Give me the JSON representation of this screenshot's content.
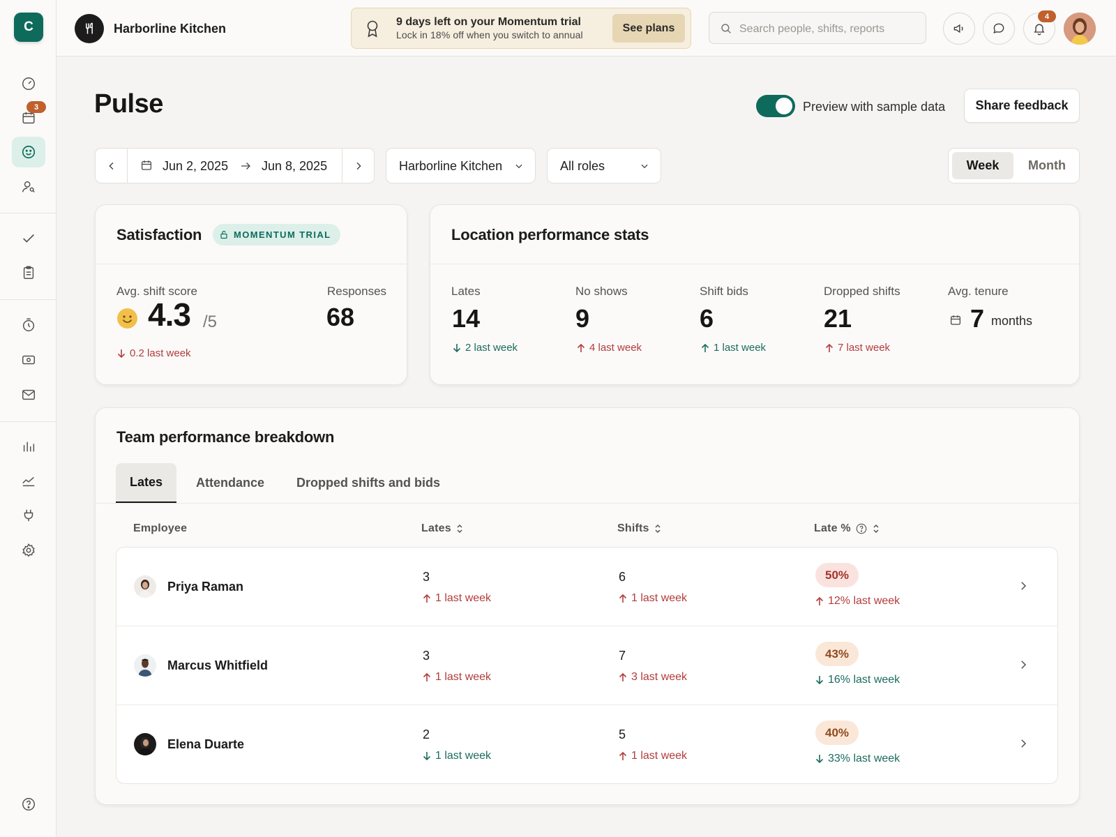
{
  "app": {
    "logo_letter": "C",
    "org_name": "Harborline Kitchen"
  },
  "sidebar": {
    "schedule_badge": "3",
    "items": [
      {
        "name": "dashboard"
      },
      {
        "name": "schedule"
      },
      {
        "name": "pulse"
      },
      {
        "name": "team"
      },
      {
        "name": "tasks"
      },
      {
        "name": "checklists"
      },
      {
        "name": "timesheets"
      },
      {
        "name": "payroll"
      },
      {
        "name": "messages"
      },
      {
        "name": "reports"
      },
      {
        "name": "insights"
      },
      {
        "name": "integrations"
      },
      {
        "name": "settings"
      },
      {
        "name": "help"
      }
    ]
  },
  "banner": {
    "title": "9 days left on your Momentum trial",
    "subtitle": "Lock in 18% off when you switch to annual",
    "cta": "See plans"
  },
  "search": {
    "placeholder": "Search people, shifts, reports"
  },
  "notifications": {
    "count": "4"
  },
  "page": {
    "title": "Pulse",
    "toggle_label": "Preview with sample data",
    "toggle_on": true,
    "share_label": "Share feedback"
  },
  "filters": {
    "start_date": "Jun 2, 2025",
    "end_date": "Jun 8, 2025",
    "location": "Harborline Kitchen",
    "role": "All roles",
    "period_options": [
      "Week",
      "Month"
    ],
    "period_selected": "Week"
  },
  "satisfaction": {
    "title": "Satisfaction",
    "badge": "MOMENTUM TRIAL",
    "score_label": "Avg. shift score",
    "score": "4.3",
    "score_max": "/5",
    "score_trend": "0.2 last week",
    "responses_label": "Responses",
    "responses": "68"
  },
  "location_stats": {
    "title": "Location performance stats",
    "stats": [
      {
        "label": "Lates",
        "value": "14",
        "trend": "2 last week",
        "direction": "down",
        "tone": "green"
      },
      {
        "label": "No shows",
        "value": "9",
        "trend": "4 last week",
        "direction": "up",
        "tone": "red"
      },
      {
        "label": "Shift bids",
        "value": "6",
        "trend": "1 last week",
        "direction": "up",
        "tone": "green"
      },
      {
        "label": "Dropped shifts",
        "value": "21",
        "trend": "7 last week",
        "direction": "up",
        "tone": "red"
      },
      {
        "label": "Avg. tenure",
        "value": "7",
        "unit": "months"
      }
    ]
  },
  "team": {
    "title": "Team performance breakdown",
    "tabs": [
      "Lates",
      "Attendance",
      "Dropped shifts and bids"
    ],
    "active_tab": "Lates",
    "columns": [
      "Employee",
      "Lates",
      "Shifts",
      "Late %"
    ],
    "rows": [
      {
        "name": "Priya Raman",
        "lates": "3",
        "lates_trend": "1 last week",
        "lates_dir": "up",
        "lates_tone": "red",
        "shifts": "6",
        "shifts_trend": "1 last week",
        "shifts_dir": "up",
        "shifts_tone": "red",
        "late_pct": "50%",
        "pct_trend": "12% last week",
        "pct_dir": "up",
        "pct_tone": "red",
        "pill": "hi"
      },
      {
        "name": "Marcus Whitfield",
        "lates": "3",
        "lates_trend": "1 last week",
        "lates_dir": "up",
        "lates_tone": "red",
        "shifts": "7",
        "shifts_trend": "3 last week",
        "shifts_dir": "up",
        "shifts_tone": "red",
        "late_pct": "43%",
        "pct_trend": "16% last week",
        "pct_dir": "down",
        "pct_tone": "green",
        "pill": "mid"
      },
      {
        "name": "Elena Duarte",
        "lates": "2",
        "lates_trend": "1 last week",
        "lates_dir": "down",
        "lates_tone": "green",
        "shifts": "5",
        "shifts_trend": "1 last week",
        "shifts_dir": "up",
        "shifts_tone": "red",
        "late_pct": "40%",
        "pct_trend": "33% last week",
        "pct_dir": "down",
        "pct_tone": "green",
        "pill": "mid"
      }
    ]
  },
  "colors": {
    "brand": "#0e6b5c",
    "alert": "#c0602d",
    "negative": "#b23c3c",
    "positive": "#1b6b5d"
  }
}
